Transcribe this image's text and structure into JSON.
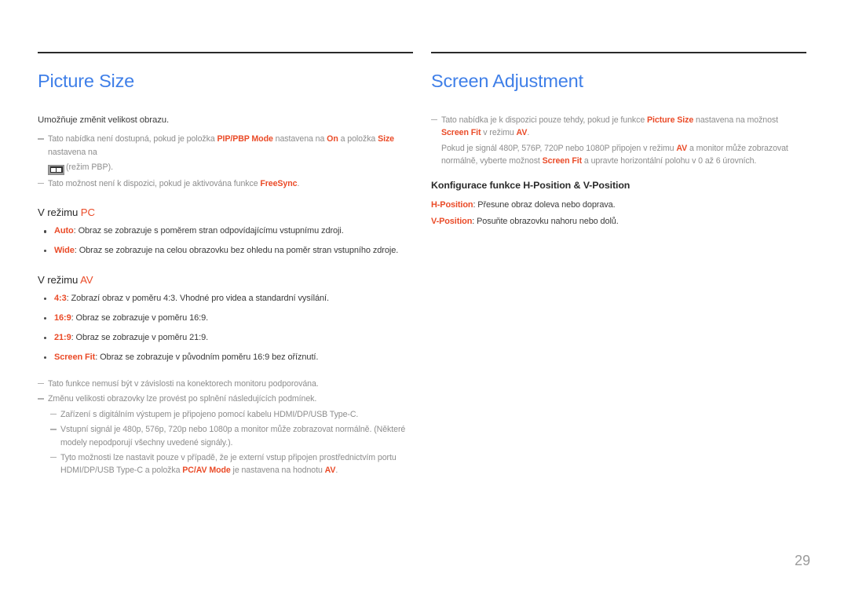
{
  "page": {
    "number": "29",
    "accent_blue": "#3f7fe8",
    "accent_red": "#ea4b28",
    "note_gray": "#8d8d8d",
    "body_gray": "#3b3b3b"
  },
  "left_column": {
    "title": "Picture Size",
    "intro": "Umožňuje změnit velikost obrazu.",
    "note1": {
      "part1": "Tato nabídka není dostupná, pokud je položka ",
      "hl1": "PIP/PBP Mode",
      "part2": " nastavena na ",
      "hl2": "On",
      "part3": " a položka ",
      "hl3": "Size",
      "part4": " nastavena na",
      "icon": "pbp-mode-icon",
      "icon_caption": "(režim PBP)."
    },
    "note2": {
      "part1": "Tato možnost není k dispozici, pokud je aktivována funkce ",
      "hl1": "FreeSync",
      "part2": "."
    },
    "pc_heading": {
      "prefix": "V režimu ",
      "mode": "PC"
    },
    "pc_bullets": [
      {
        "term": "Auto",
        "desc": ": Obraz se zobrazuje s poměrem stran odpovídajícímu vstupnímu zdroji."
      },
      {
        "term": "Wide",
        "desc": ": Obraz se zobrazuje na celou obrazovku bez ohledu na poměr stran vstupního zdroje."
      }
    ],
    "av_heading": {
      "prefix": "V režimu ",
      "mode": "AV"
    },
    "av_bullets": [
      {
        "term": "4:3",
        "desc": ": Zobrazí obraz v poměru 4:3. Vhodné pro videa a standardní vysílání."
      },
      {
        "term": "16:9",
        "desc": ": Obraz se zobrazuje v poměru 16:9."
      },
      {
        "term": "21:9",
        "desc": ": Obraz se zobrazuje v poměru 21:9."
      },
      {
        "term": "Screen Fit",
        "desc": ": Obraz se zobrazuje v původním poměru 16:9 bez oříznutí."
      }
    ],
    "note3": "Tato funkce nemusí být v závislosti na konektorech monitoru podporována.",
    "note4": "Změnu velikosti obrazovky lze provést po splnění následujících podmínek.",
    "note4_sub1": "Zařízení s digitálním výstupem je připojeno pomocí kabelu HDMI/DP/USB Type-C.",
    "note4_sub2": "Vstupní signál je 480p, 576p, 720p nebo 1080p a monitor může zobrazovat normálně. (Některé modely nepodporují všechny uvedené signály.).",
    "note5": {
      "part1": "Tyto možnosti lze nastavit pouze v případě, že je externí vstup připojen prostřednictvím portu HDMI/DP/USB Type-C a položka ",
      "hl1": "PC/AV Mode",
      "part2": " je nastavena na hodnotu ",
      "hl2": "AV",
      "part3": "."
    }
  },
  "right_column": {
    "title": "Screen Adjustment",
    "note1": {
      "part1": "Tato nabídka je k dispozici pouze tehdy, pokud je funkce ",
      "hl1": "Picture Size",
      "part2": " nastavena na možnost ",
      "hl2": "Screen Fit",
      "part3": " v režimu ",
      "hl3": "AV",
      "part4": "."
    },
    "note1_cont": {
      "part1": "Pokud je signál 480P, 576P, 720P nebo 1080P připojen v režimu ",
      "hl1": "AV",
      "part2": " a monitor může zobrazovat normálně, vyberte možnost ",
      "hl2": "Screen Fit",
      "part3": " a upravte horizontální polohu v 0 až 6 úrovních."
    },
    "config_heading": "Konfigurace funkce H-Position & V-Position",
    "config_lines": [
      {
        "term": "H-Position",
        "desc": ": Přesune obraz doleva nebo doprava."
      },
      {
        "term": "V-Position",
        "desc": ": Posuňte obrazovku nahoru nebo dolů."
      }
    ]
  }
}
